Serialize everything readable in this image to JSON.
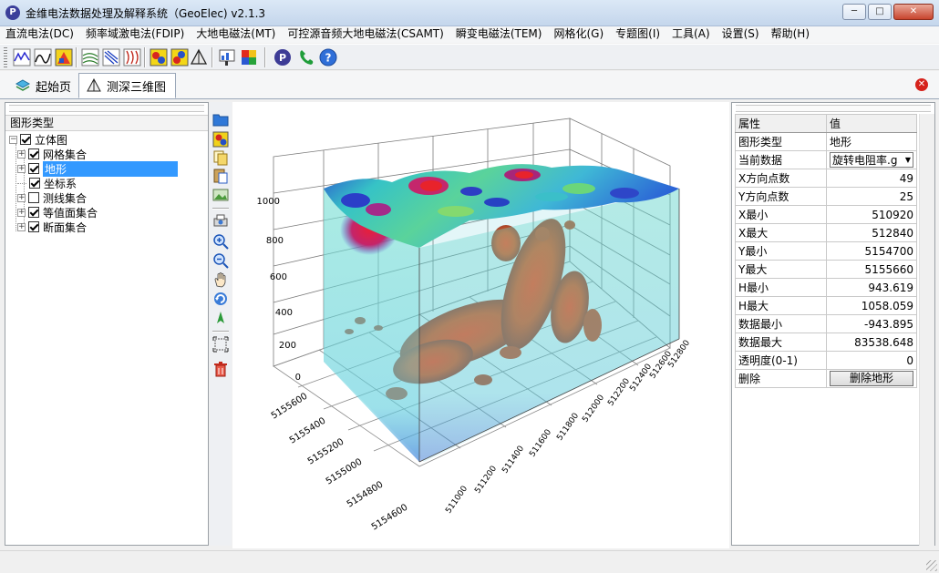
{
  "window": {
    "title": "金维电法数据处理及解释系统（GeoElec)  v2.1.3",
    "app_icon_letter": "P"
  },
  "menu": [
    "直流电法(DC)",
    "频率域激电法(FDIP)",
    "大地电磁法(MT)",
    "可控源音频大地电磁法(CSAMT)",
    "瞬变电磁法(TEM)",
    "网格化(G)",
    "专题图(I)",
    "工具(A)",
    "设置(S)",
    "帮助(H)"
  ],
  "tabs": [
    {
      "label": "起始页"
    },
    {
      "label": "测深三维图"
    }
  ],
  "tree": {
    "header": "图形类型",
    "root": "立体图",
    "items": [
      {
        "label": "网格集合",
        "checked": true,
        "expandable": true
      },
      {
        "label": "地形",
        "checked": true,
        "expandable": true,
        "selected": true
      },
      {
        "label": "坐标系",
        "checked": true,
        "expandable": false
      },
      {
        "label": "测线集合",
        "checked": false,
        "expandable": true
      },
      {
        "label": "等值面集合",
        "checked": true,
        "expandable": true
      },
      {
        "label": "断面集合",
        "checked": true,
        "expandable": true
      }
    ]
  },
  "plot": {
    "z_ticks": [
      "0",
      "200",
      "400",
      "600",
      "800",
      "1000"
    ],
    "y_ticks": [
      "5155600",
      "5155400",
      "5155200",
      "5155000",
      "5154800",
      "5154600"
    ],
    "x_ticks": [
      "511000",
      "511200",
      "511400",
      "511600",
      "511800",
      "512000",
      "512200",
      "512400",
      "512600",
      "512800"
    ]
  },
  "properties": {
    "header_name": "属性",
    "header_value": "值",
    "rows": [
      {
        "name": "图形类型",
        "value": "地形",
        "kind": "text"
      },
      {
        "name": "当前数据",
        "value": "旋转电阻率.g",
        "kind": "combo"
      },
      {
        "name": "X方向点数",
        "value": "49",
        "kind": "num"
      },
      {
        "name": "Y方向点数",
        "value": "25",
        "kind": "num"
      },
      {
        "name": "X最小",
        "value": "510920",
        "kind": "num"
      },
      {
        "name": "X最大",
        "value": "512840",
        "kind": "num"
      },
      {
        "name": "Y最小",
        "value": "5154700",
        "kind": "num"
      },
      {
        "name": "Y最大",
        "value": "5155660",
        "kind": "num"
      },
      {
        "name": "H最小",
        "value": "943.619",
        "kind": "num"
      },
      {
        "name": "H最大",
        "value": "1058.059",
        "kind": "num"
      },
      {
        "name": "数据最小",
        "value": "-943.895",
        "kind": "num"
      },
      {
        "name": "数据最大",
        "value": "83538.648",
        "kind": "num"
      },
      {
        "name": "透明度(0-1)",
        "value": "0",
        "kind": "num"
      },
      {
        "name": "删除",
        "value": "删除地形",
        "kind": "button"
      }
    ]
  },
  "colors": {
    "selection": "#3399ff",
    "terrain_high": "#d9262c",
    "terrain_low": "#1e3fbf",
    "volume_teal": "#5fd3c4",
    "isosurface": "#d2531e"
  }
}
